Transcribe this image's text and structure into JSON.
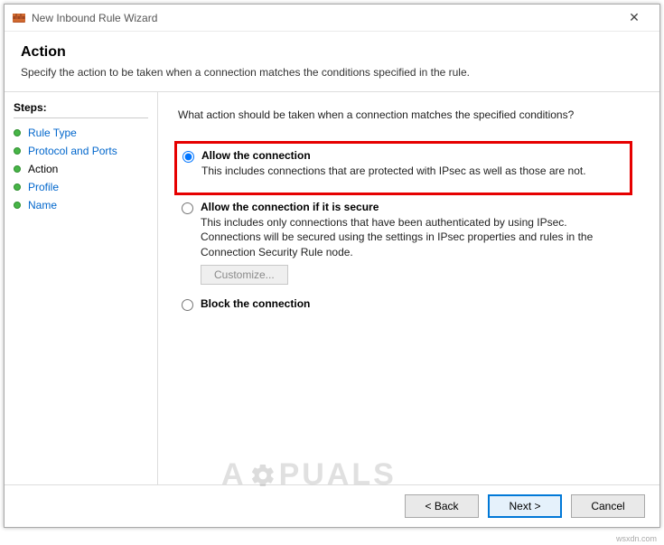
{
  "window": {
    "title": "New Inbound Rule Wizard",
    "close_glyph": "✕"
  },
  "header": {
    "title": "Action",
    "description": "Specify the action to be taken when a connection matches the conditions specified in the rule."
  },
  "sidebar": {
    "header": "Steps:",
    "items": [
      {
        "label": "Rule Type",
        "current": false
      },
      {
        "label": "Protocol and Ports",
        "current": false
      },
      {
        "label": "Action",
        "current": true
      },
      {
        "label": "Profile",
        "current": false
      },
      {
        "label": "Name",
        "current": false
      }
    ]
  },
  "main": {
    "prompt": "What action should be taken when a connection matches the specified conditions?",
    "options": {
      "allow": {
        "label": "Allow the connection",
        "desc": "This includes connections that are protected with IPsec as well as those are not."
      },
      "allow_secure": {
        "label": "Allow the connection if it is secure",
        "desc": "This includes only connections that have been authenticated by using IPsec. Connections will be secured using the settings in IPsec properties and rules in the Connection Security Rule node.",
        "customize_label": "Customize..."
      },
      "block": {
        "label": "Block the connection"
      }
    },
    "selected": "allow"
  },
  "footer": {
    "back": "< Back",
    "next": "Next >",
    "cancel": "Cancel"
  },
  "watermark": "A   PUALS",
  "credit": "wsxdn.com"
}
